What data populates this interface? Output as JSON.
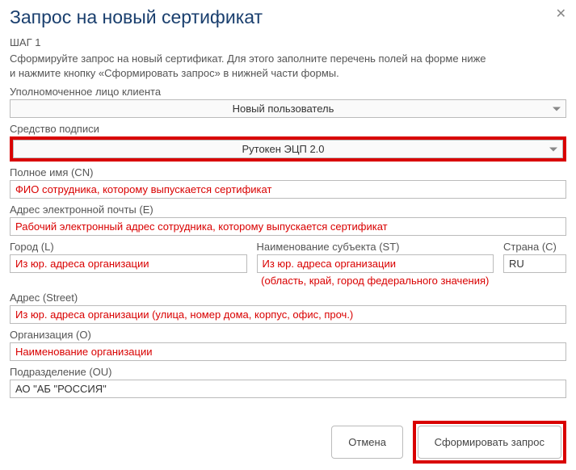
{
  "dialog": {
    "title": "Запрос на новый сертификат",
    "close_glyph": "✕"
  },
  "step": {
    "label": "ШАГ 1",
    "instructions_line1": "Сформируйте запрос на новый сертификат. Для этого заполните перечень полей на форме ниже",
    "instructions_line2": "и нажмите кнопку «Сформировать запрос» в нижней части формы."
  },
  "fields": {
    "authorized_person": {
      "label": "Уполномоченное лицо клиента",
      "value": "Новый пользователь"
    },
    "sign_tool": {
      "label": "Средство подписи",
      "value": "Рутокен ЭЦП 2.0"
    },
    "full_name": {
      "label": "Полное имя (CN)",
      "value": "ФИО сотрудника, которому выпускается сертификат"
    },
    "email": {
      "label": "Адрес электронной почты (E)",
      "value": "Рабочий электронный адрес сотрудника, которому выпускается сертификат"
    },
    "city": {
      "label": "Город (L)",
      "value": "Из юр. адреса организации"
    },
    "subject": {
      "label": "Наименование субъекта (ST)",
      "value": "Из юр. адреса организации",
      "note": "(область, край, город федерального значения)"
    },
    "country": {
      "label": "Страна (C)",
      "value": "RU"
    },
    "street": {
      "label": "Адрес (Street)",
      "value": "Из юр. адреса организации (улица, номер дома, корпус, офис, проч.)"
    },
    "organization": {
      "label": "Организация (O)",
      "value": "Наименование организации"
    },
    "org_unit": {
      "label": "Подразделение (OU)",
      "value": "АО \"АБ \"РОССИЯ\""
    }
  },
  "buttons": {
    "cancel": "Отмена",
    "submit": "Сформировать запрос"
  }
}
